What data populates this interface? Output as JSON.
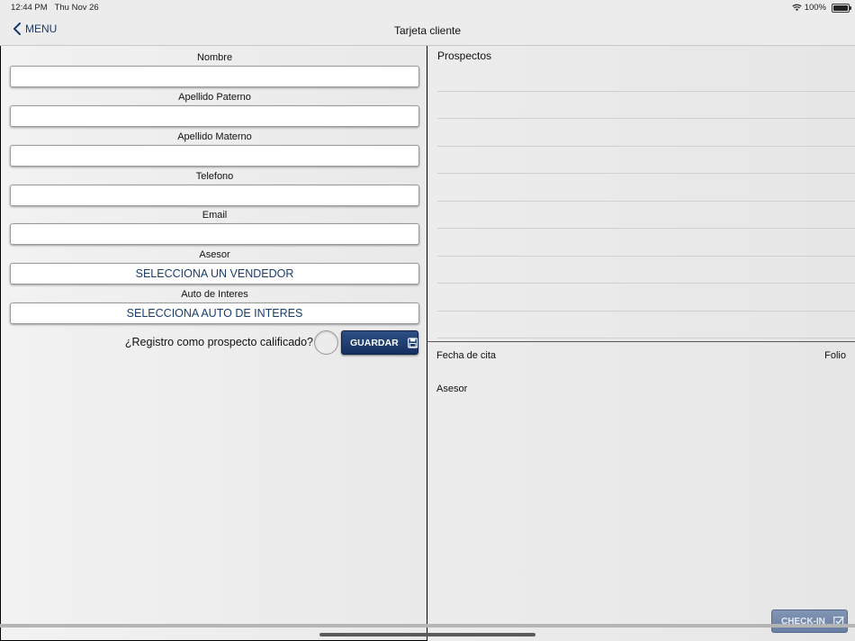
{
  "status_bar": {
    "time": "12:44 PM",
    "date": "Thu Nov 26",
    "battery": "100%"
  },
  "nav": {
    "back_label": "MENU",
    "title": "Tarjeta cliente"
  },
  "form": {
    "nombre_label": "Nombre",
    "paterno_label": "Apellido Paterno",
    "materno_label": "Apellido Materno",
    "telefono_label": "Telefono",
    "email_label": "Email",
    "asesor_label": "Asesor",
    "asesor_value": "SELECCIONA UN VENDEDOR",
    "auto_label": "Auto de Interes",
    "auto_value": "SELECCIONA AUTO DE INTERES",
    "qualify_label": "¿Registro como prospecto calificado?",
    "save_label": "GUARDAR"
  },
  "right": {
    "prospects_title": "Prospectos",
    "fecha_label": "Fecha de cita",
    "folio_label": "Folio",
    "asesor_label": "Asesor",
    "checkin_label": "CHECK-IN"
  },
  "colors": {
    "accent": "#1b3d6e",
    "button": "#1f3c6f"
  },
  "icons": {
    "back": "chevron-left-icon",
    "save": "floppy-disk-icon",
    "checkin": "checkbox-icon",
    "wifi": "wifi-icon",
    "battery": "battery-icon"
  }
}
